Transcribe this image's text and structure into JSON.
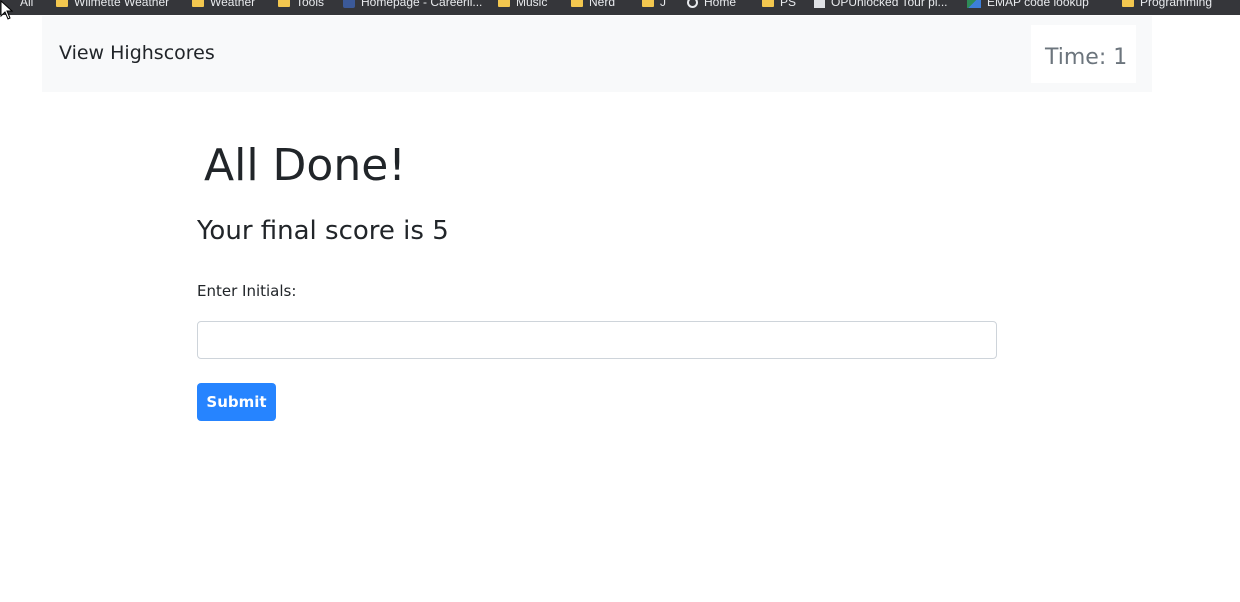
{
  "bookmarks": {
    "items": [
      {
        "label": "All",
        "icon": "none"
      },
      {
        "label": "Wilmette Weather",
        "icon": "folder-icon"
      },
      {
        "label": "Weather",
        "icon": "folder-icon"
      },
      {
        "label": "Tools",
        "icon": "folder-icon"
      },
      {
        "label": "Homepage - Careerli...",
        "icon": "facebook-icon"
      },
      {
        "label": "Music",
        "icon": "folder-icon"
      },
      {
        "label": "Nerd",
        "icon": "folder-icon"
      },
      {
        "label": "J",
        "icon": "folder-icon"
      },
      {
        "label": "Home",
        "icon": "globe-icon"
      },
      {
        "label": "PS",
        "icon": "folder-icon"
      },
      {
        "label": "OPUnlocked Tour pi...",
        "icon": "page-icon"
      },
      {
        "label": "EMAP code lookup",
        "icon": "map-icon"
      },
      {
        "label": "Programming",
        "icon": "folder-icon"
      }
    ]
  },
  "navbar": {
    "highscores_label": "View Highscores",
    "timer_text": "Time: 1"
  },
  "main": {
    "title": "All Done!",
    "score_text": "Your final score is 5",
    "initials_label": "Enter Initials:",
    "initials_value": "",
    "initials_placeholder": "",
    "submit_label": "Submit"
  },
  "colors": {
    "accent": "#2684ff",
    "navbar_bg": "#f8f9fa",
    "timer_text": "#6c757d",
    "bookmarks_bg": "#35363a"
  }
}
